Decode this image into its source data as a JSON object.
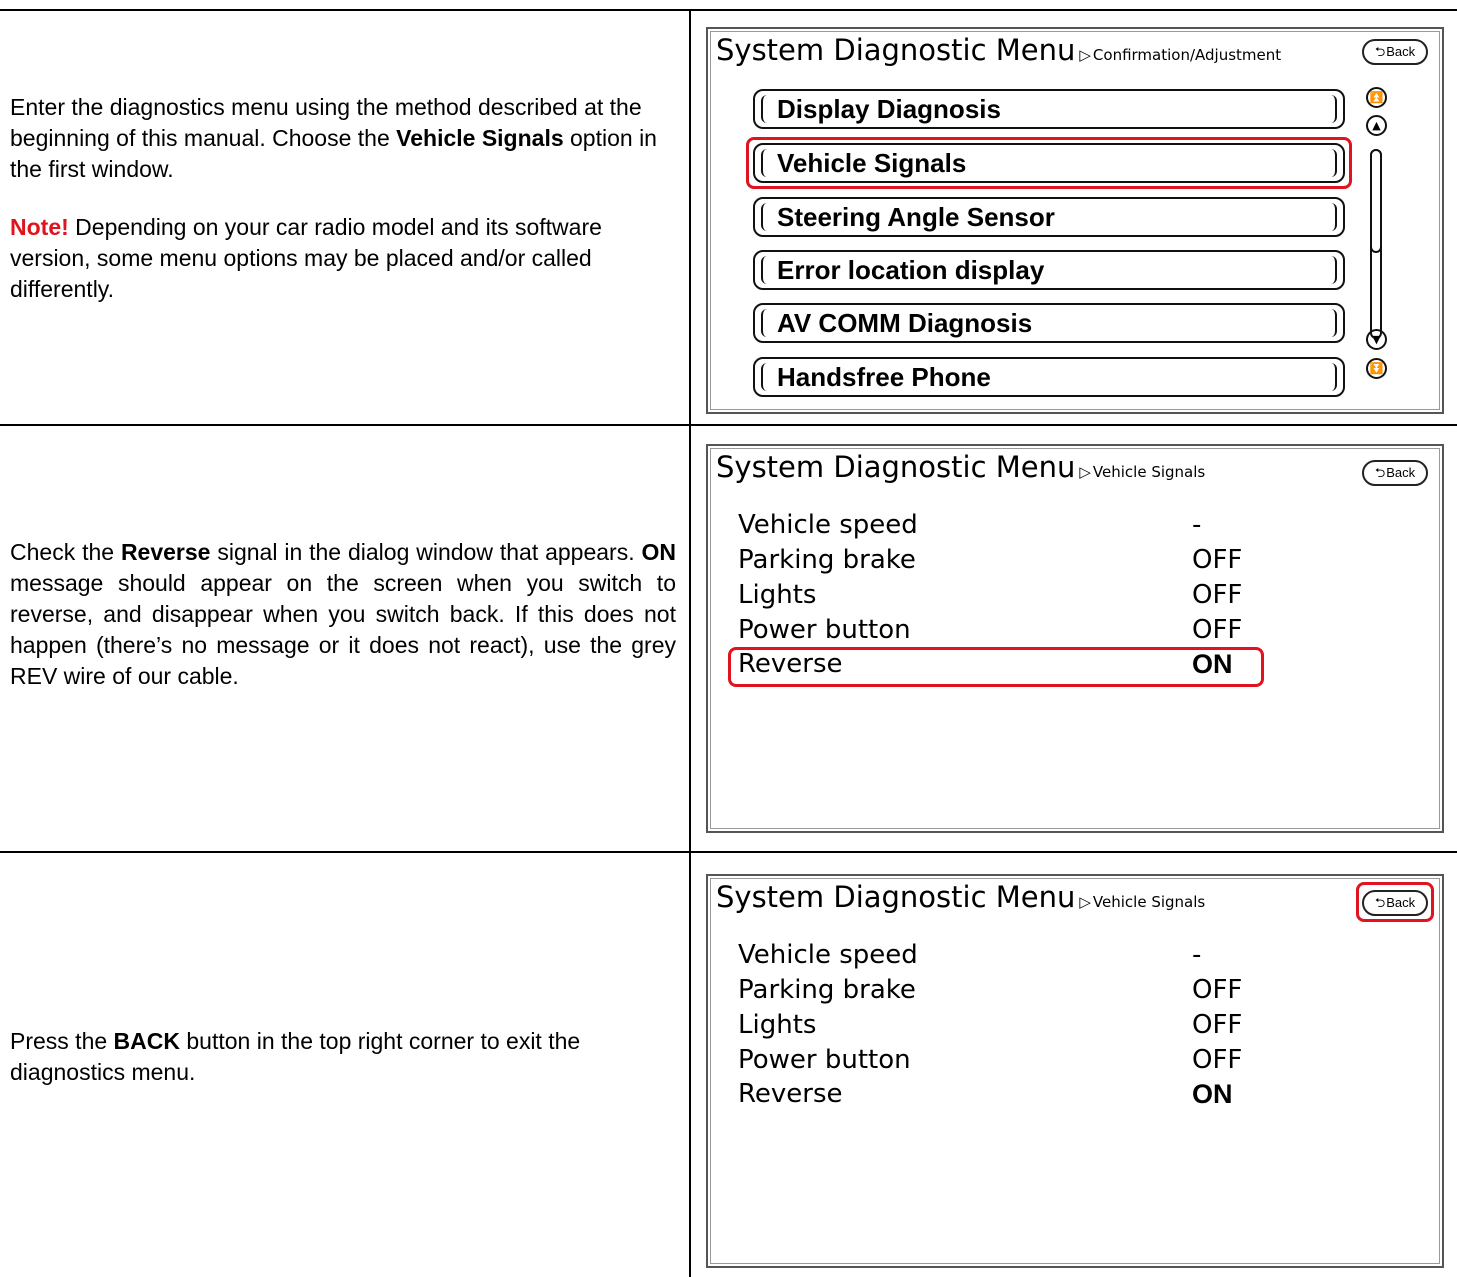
{
  "rows": [
    {
      "instruction": {
        "p1_pre": "Enter the diagnostics menu using the method described at the beginning of this manual.  Choose the ",
        "p1_bold": "Vehicle Signals",
        "p1_post": " option in the first window.",
        "note_label": "Note!",
        "note_text": " Depending on your car radio model and its software version,  some menu options may be placed and/or called differently."
      },
      "screen": {
        "title": "System Diagnostic Menu",
        "subtitle": "Confirmation/Adjustment",
        "back_label": "Back",
        "menu_items": [
          "Display Diagnosis",
          "Vehicle Signals",
          "Steering Angle Sensor",
          "Error location display",
          "AV COMM Diagnosis",
          "Handsfree Phone"
        ],
        "highlighted": "Vehicle Signals"
      }
    },
    {
      "instruction": {
        "pre1": "Check the ",
        "bold1": "Reverse",
        "mid1": " signal in the dialog window that appears.  ",
        "bold2": "ON",
        "post": " message should appear on the screen when you switch to reverse, and disappear when you switch back. If this does not happen (there’s no message or it does not react), use the grey REV  wire of our cable."
      },
      "screen": {
        "title": "System Diagnostic Menu",
        "subtitle": "Vehicle Signals",
        "back_label": "Back",
        "signals": [
          {
            "label": "Vehicle speed",
            "value": "-"
          },
          {
            "label": "Parking brake",
            "value": "OFF"
          },
          {
            "label": "Lights",
            "value": "OFF"
          },
          {
            "label": "Power button",
            "value": "OFF"
          },
          {
            "label": "Reverse",
            "value": "ON"
          }
        ],
        "highlighted": "Reverse"
      }
    },
    {
      "instruction": {
        "pre": "Press the  ",
        "bold": "BACK",
        "post": "  button in the top right corner to exit the diagnostics menu."
      },
      "screen": {
        "title": "System Diagnostic Menu",
        "subtitle": "Vehicle Signals",
        "back_label": "Back",
        "signals": [
          {
            "label": "Vehicle speed",
            "value": "-"
          },
          {
            "label": "Parking brake",
            "value": "OFF"
          },
          {
            "label": "Lights",
            "value": "OFF"
          },
          {
            "label": "Power button",
            "value": "OFF"
          },
          {
            "label": "Reverse",
            "value": "ON"
          }
        ],
        "highlighted": "Back"
      }
    }
  ],
  "colors": {
    "highlight": "#e0141e",
    "note": "#e0141e"
  },
  "icons": [
    "page-up-icon",
    "up-icon",
    "down-icon",
    "page-down-icon",
    "back-arrow-icon",
    "triangle-right-icon"
  ]
}
